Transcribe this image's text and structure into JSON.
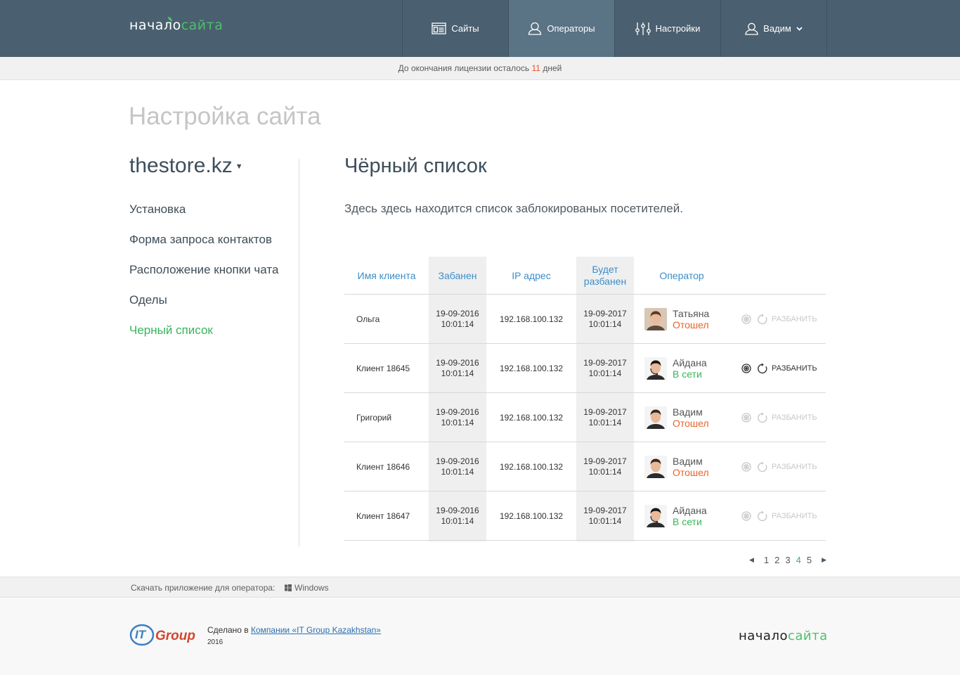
{
  "header": {
    "logo_a": "начало",
    "logo_b": "сайта",
    "nav": [
      {
        "label": "Сайты",
        "icon": "sites-icon"
      },
      {
        "label": "Операторы",
        "icon": "operators-icon",
        "active": true
      },
      {
        "label": "Настройки",
        "icon": "settings-sliders-icon"
      },
      {
        "label": "Вадим",
        "icon": "user-icon"
      }
    ]
  },
  "license": {
    "prefix": "До окончания лицензии осталось",
    "days": "11",
    "suffix": "дней"
  },
  "page_title": "Настройка сайта",
  "sidebar": {
    "site": "thestore.kz",
    "items": [
      {
        "label": "Установка"
      },
      {
        "label": "Форма запроса контактов"
      },
      {
        "label": "Расположение кнопки чата"
      },
      {
        "label": "Оделы"
      },
      {
        "label": "Черный список",
        "active": true
      }
    ]
  },
  "content": {
    "title": "Чёрный список",
    "description": "Здесь здесь находится список заблокированых посетителей."
  },
  "table": {
    "headers": {
      "client": "Имя клиента",
      "banned": "Забанен",
      "ip": "IP адрес",
      "unban_1": "Будет",
      "unban_2": "разбанен",
      "operator": "Оператор"
    },
    "action_label": "РАЗБАНИТЬ",
    "rows": [
      {
        "client": "Ольга",
        "ban_date": "19-09-2016",
        "ban_time": "10:01:14",
        "ip": "192.168.100.132",
        "unban_date": "19-09-2017",
        "unban_time": "10:01:14",
        "operator": "Татьяна",
        "status": "Отошел",
        "status_type": "away"
      },
      {
        "client": "Клиент 18645",
        "ban_date": "19-09-2016",
        "ban_time": "10:01:14",
        "ip": "192.168.100.132",
        "unban_date": "19-09-2017",
        "unban_time": "10:01:14",
        "operator": "Айдана",
        "status": "В сети",
        "status_type": "online",
        "highlighted": true
      },
      {
        "client": "Григорий",
        "ban_date": "19-09-2016",
        "ban_time": "10:01:14",
        "ip": "192.168.100.132",
        "unban_date": "19-09-2017",
        "unban_time": "10:01:14",
        "operator": "Вадим",
        "status": "Отошел",
        "status_type": "away"
      },
      {
        "client": "Клиент 18646",
        "ban_date": "19-09-2016",
        "ban_time": "10:01:14",
        "ip": "192.168.100.132",
        "unban_date": "19-09-2017",
        "unban_time": "10:01:14",
        "operator": "Вадим",
        "status": "Отошел",
        "status_type": "away"
      },
      {
        "client": "Клиент 18647",
        "ban_date": "19-09-2016",
        "ban_time": "10:01:14",
        "ip": "192.168.100.132",
        "unban_date": "19-09-2017",
        "unban_time": "10:01:14",
        "operator": "Айдана",
        "status": "В сети",
        "status_type": "online"
      }
    ]
  },
  "pagination": {
    "pages": [
      "1",
      "2",
      "3",
      "4",
      "5"
    ],
    "current": "4"
  },
  "footer": {
    "download_label": "Скачать приложение для оператора:",
    "windows": "Windows",
    "itgroup_it": "IT",
    "itgroup_group": "Group",
    "made_prefix": "Сделано в",
    "made_link": "Компании «IT Group Kazakhstan»",
    "year": "2016",
    "logo_a": "начало",
    "logo_b": "сайта"
  },
  "colors": {
    "header_bg": "#4a6070",
    "accent_green": "#37b55a",
    "link_blue": "#3b8ec9",
    "away_orange": "#e8642b"
  }
}
